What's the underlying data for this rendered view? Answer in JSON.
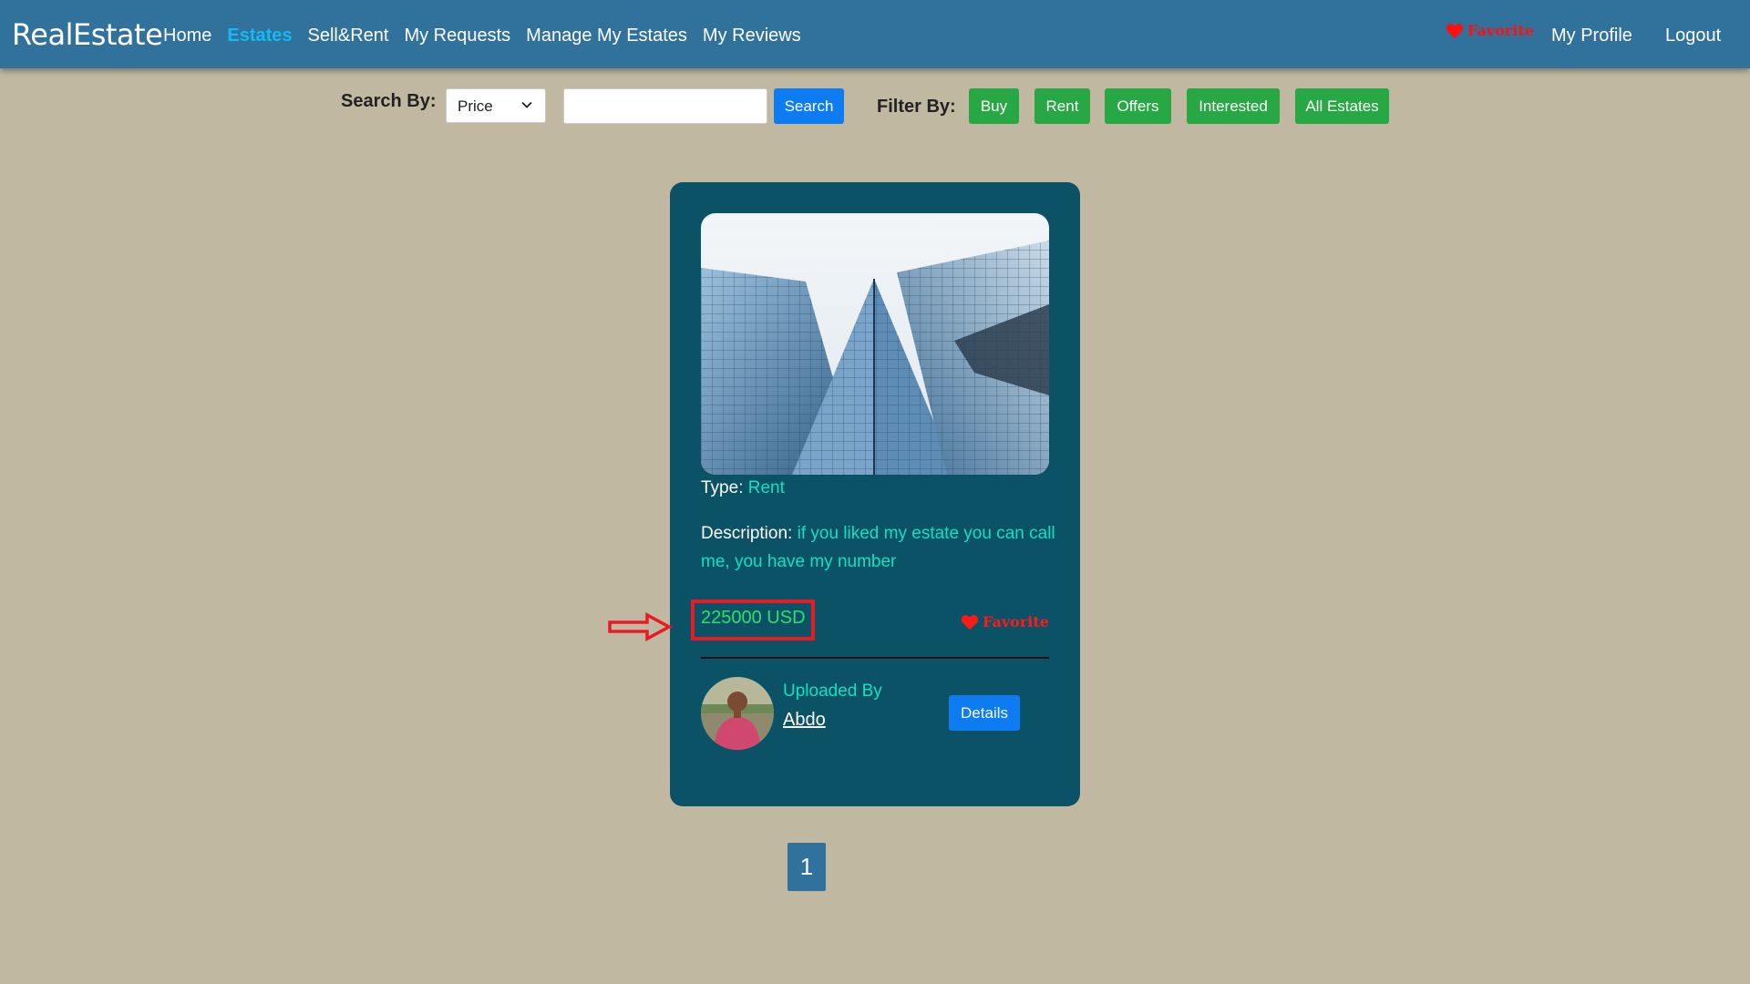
{
  "app": {
    "brand": "RealEstate"
  },
  "nav": {
    "links": [
      "Home",
      "Estates",
      "Sell&Rent",
      "My Requests",
      "Manage My Estates",
      "My Reviews"
    ],
    "active": "Estates",
    "favorite": "Favorite",
    "my_profile": "My Profile",
    "logout": "Logout"
  },
  "search": {
    "label": "Search By:",
    "selected_option": "Price",
    "input_value": "",
    "button": "Search"
  },
  "filter": {
    "label": "Filter By:",
    "buttons": [
      "Buy",
      "Rent",
      "Offers",
      "Interested",
      "All Estates"
    ]
  },
  "card": {
    "type_label": "Type:",
    "type_value": "Rent",
    "description_label": "Description:",
    "description_value": "if you liked my estate you can call me, you have my number",
    "price": "225000 USD",
    "favorite": "Favorite",
    "uploaded_by_label": "Uploaded By",
    "uploader": "Abdo",
    "details_button": "Details"
  },
  "pagination": {
    "current_page": "1"
  },
  "colors": {
    "navbar": "#31729c",
    "active_nav": "#16b9f3",
    "background": "#c0b8a1",
    "card": "#0b5266",
    "accent_cyan": "#11e0c4",
    "price_green": "#2ee06a",
    "primary_button": "#0d7cf2",
    "filter_button": "#28a745",
    "favorite_red": "#ff1010",
    "annotation_red": "#e81a24"
  },
  "icons": [
    "heart-icon",
    "chevron-down-icon",
    "arrow-right-icon"
  ]
}
